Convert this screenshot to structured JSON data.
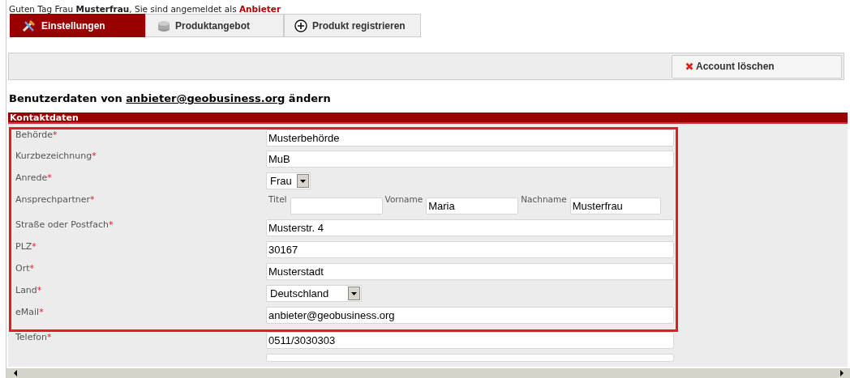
{
  "greeting": {
    "text": "Guten Tag Frau **Musterfrau**, Sie sind angemeldet als ",
    "role": "Anbieter"
  },
  "tabs": [
    {
      "label": "Einstellungen",
      "kind": "settings",
      "selected": true
    },
    {
      "label": "Produktangebot",
      "kind": "products",
      "selected": false
    },
    {
      "label": "Produkt registrieren",
      "kind": "register",
      "selected": false
    }
  ],
  "toolbar": {
    "delete_button": "Account löschen"
  },
  "heading": {
    "prefix": "Benutzerdaten von ",
    "email": "anbieter@geobusiness.org",
    "suffix": " ändern"
  },
  "section": {
    "title": "Kontaktdaten"
  },
  "highlighted_rows": [
    {
      "label": "Behörde",
      "kind": "text",
      "value": "Musterbehörde"
    },
    {
      "label": "Kurzbezeichnung",
      "kind": "text",
      "value": "MuB"
    },
    {
      "label": "Anrede",
      "kind": "select",
      "value": "Frau"
    },
    {
      "label": "Ansprechpartner",
      "kind": "name",
      "parts": [
        {
          "label": "Titel"
        },
        {
          "label": "Vorname",
          "value": "Maria"
        },
        {
          "label": "Nachname",
          "value": "Musterfrau"
        }
      ]
    },
    {
      "label": "Straße oder Postfach",
      "kind": "text",
      "value": "Musterstr. 4"
    },
    {
      "label": "PLZ",
      "kind": "text",
      "value": "30167"
    },
    {
      "label": "Ort",
      "kind": "text",
      "value": "Musterstadt"
    },
    {
      "label": "Land",
      "kind": "select",
      "value": "Deutschland"
    },
    {
      "label": "eMail",
      "kind": "text",
      "value": "anbieter@geobusiness.org"
    }
  ],
  "rows": [
    {
      "label": "Telefon",
      "kind": "text",
      "value": "0511/3030303"
    }
  ],
  "required_mark": "*"
}
